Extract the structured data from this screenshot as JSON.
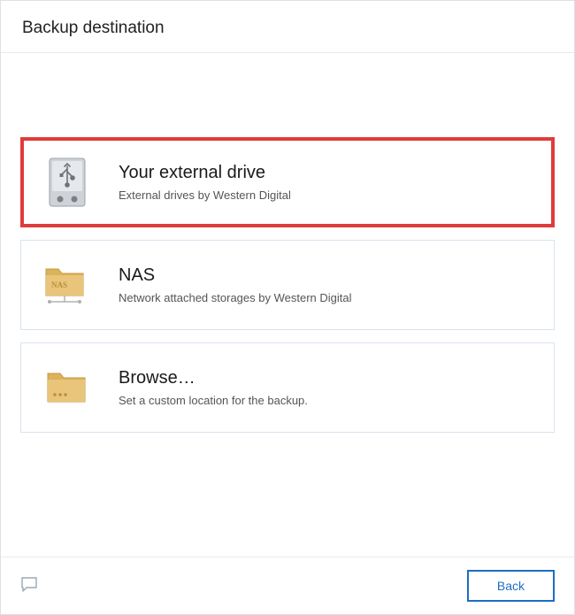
{
  "header": {
    "title": "Backup destination"
  },
  "options": {
    "external": {
      "title": "Your external drive",
      "subtitle": "External drives by Western Digital"
    },
    "nas": {
      "title": "NAS",
      "subtitle": "Network attached storages by Western Digital"
    },
    "browse": {
      "title": "Browse…",
      "subtitle": "Set a custom location for the backup."
    }
  },
  "footer": {
    "back_label": "Back"
  }
}
